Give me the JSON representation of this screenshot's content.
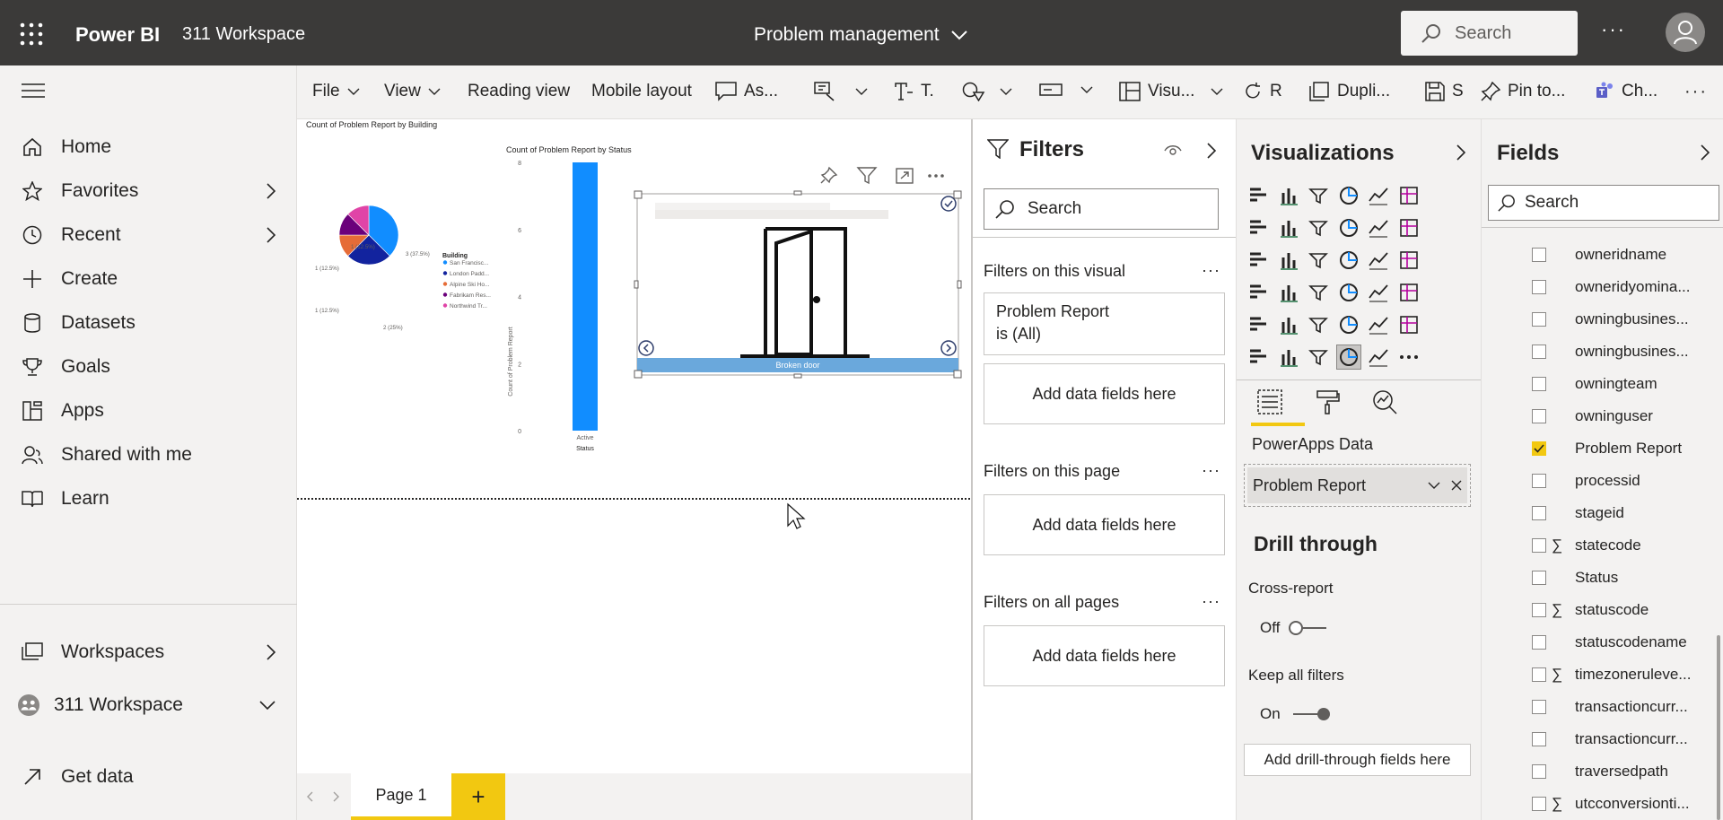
{
  "header": {
    "app_name": "Power BI",
    "workspace": "311 Workspace",
    "report_title": "Problem management",
    "search_placeholder": "Search",
    "more": "···"
  },
  "nav": {
    "items": [
      {
        "label": "Home",
        "icon": "home-icon"
      },
      {
        "label": "Favorites",
        "icon": "star-icon"
      },
      {
        "label": "Recent",
        "icon": "clock-icon"
      },
      {
        "label": "Create",
        "icon": "plus-icon"
      },
      {
        "label": "Datasets",
        "icon": "database-icon"
      },
      {
        "label": "Goals",
        "icon": "trophy-icon"
      },
      {
        "label": "Apps",
        "icon": "apps-icon"
      },
      {
        "label": "Shared with me",
        "icon": "people-icon"
      },
      {
        "label": "Learn",
        "icon": "book-icon"
      },
      {
        "label": "Workspaces",
        "icon": "workspaces-icon"
      },
      {
        "label": "311 Workspace",
        "icon": "workspace-avatar-icon"
      },
      {
        "label": "Get data",
        "icon": "arrow-up-right-icon"
      }
    ]
  },
  "toolbar": {
    "file": "File",
    "view": "View",
    "reading_view": "Reading view",
    "mobile_layout": "Mobile layout",
    "ask": "As...",
    "text": "T.",
    "visual": "Visu...",
    "refresh": "R",
    "duplicate": "Dupli...",
    "save": "S",
    "pin": "Pin to...",
    "chat": "Ch...",
    "more": "···"
  },
  "canvas": {
    "pie_title": "Count of Problem Report by Building",
    "bar_title": "Count of Problem Report by Status",
    "legend_title": "Building",
    "legend_items": [
      "San Francisc...",
      "London Padd...",
      "Alpine Ski Ho...",
      "Fabrikam Res...",
      "Northwind Tr..."
    ],
    "pie_labels": [
      "1 (12.5%)",
      "3 (37.5%)",
      "1 (12.5%)",
      "1 (12.5%)",
      "2 (25%)"
    ],
    "bar_ylabel": "Count of Problem Report",
    "bar_xlabel": "Status",
    "bar_category": "Active",
    "bar_ticks": [
      "8",
      "6",
      "4",
      "2",
      "0"
    ],
    "powerapp_caption": "Broken door"
  },
  "pages": {
    "tab": "Page 1",
    "add": "+"
  },
  "filters": {
    "title": "Filters",
    "search": "Search",
    "on_visual": "Filters on this visual",
    "visual_filter_line1": "Problem Report",
    "visual_filter_line2": "is (All)",
    "add1": "Add data fields here",
    "on_page": "Filters on this page",
    "add2": "Add data fields here",
    "on_all": "Filters on all pages",
    "add3": "Add data fields here",
    "more": "···"
  },
  "visualizations": {
    "title": "Visualizations",
    "source_label": "PowerApps Data",
    "field_chip": "Problem Report",
    "drill_title": "Drill through",
    "cross_report": "Cross-report",
    "cross_state": "Off",
    "keep_filters": "Keep all filters",
    "keep_state": "On",
    "drill_add": "Add drill-through fields here"
  },
  "fields": {
    "title": "Fields",
    "search": "Search",
    "items": [
      {
        "name": "owneridname",
        "sigma": false,
        "checked": false
      },
      {
        "name": "owneridyomina...",
        "sigma": false,
        "checked": false
      },
      {
        "name": "owningbusines...",
        "sigma": false,
        "checked": false
      },
      {
        "name": "owningbusines...",
        "sigma": false,
        "checked": false
      },
      {
        "name": "owningteam",
        "sigma": false,
        "checked": false
      },
      {
        "name": "owninguser",
        "sigma": false,
        "checked": false
      },
      {
        "name": "Problem Report",
        "sigma": false,
        "checked": true
      },
      {
        "name": "processid",
        "sigma": false,
        "checked": false
      },
      {
        "name": "stageid",
        "sigma": false,
        "checked": false
      },
      {
        "name": "statecode",
        "sigma": true,
        "checked": false
      },
      {
        "name": "Status",
        "sigma": false,
        "checked": false
      },
      {
        "name": "statuscode",
        "sigma": true,
        "checked": false
      },
      {
        "name": "statuscodename",
        "sigma": false,
        "checked": false
      },
      {
        "name": "timezoneruleve...",
        "sigma": true,
        "checked": false
      },
      {
        "name": "transactioncurr...",
        "sigma": false,
        "checked": false
      },
      {
        "name": "transactioncurr...",
        "sigma": false,
        "checked": false
      },
      {
        "name": "traversedpath",
        "sigma": false,
        "checked": false
      },
      {
        "name": "utcconversionti...",
        "sigma": true,
        "checked": false
      }
    ]
  },
  "chart_data": [
    {
      "type": "pie",
      "title": "Count of Problem Report by Building",
      "legend_title": "Building",
      "categories": [
        "San Francisc...",
        "London Padd...",
        "Alpine Ski Ho...",
        "Fabrikam Res...",
        "Northwind Tr..."
      ],
      "values": [
        3,
        2,
        1,
        1,
        1
      ],
      "colors": [
        "#118dff",
        "#12239e",
        "#e66c37",
        "#6b007b",
        "#e044a7"
      ]
    },
    {
      "type": "bar",
      "title": "Count of Problem Report by Status",
      "categories": [
        "Active"
      ],
      "values": [
        8
      ],
      "xlabel": "Status",
      "ylabel": "Count of Problem Report",
      "ylim": [
        0,
        8
      ],
      "colors": [
        "#118dff"
      ]
    }
  ]
}
